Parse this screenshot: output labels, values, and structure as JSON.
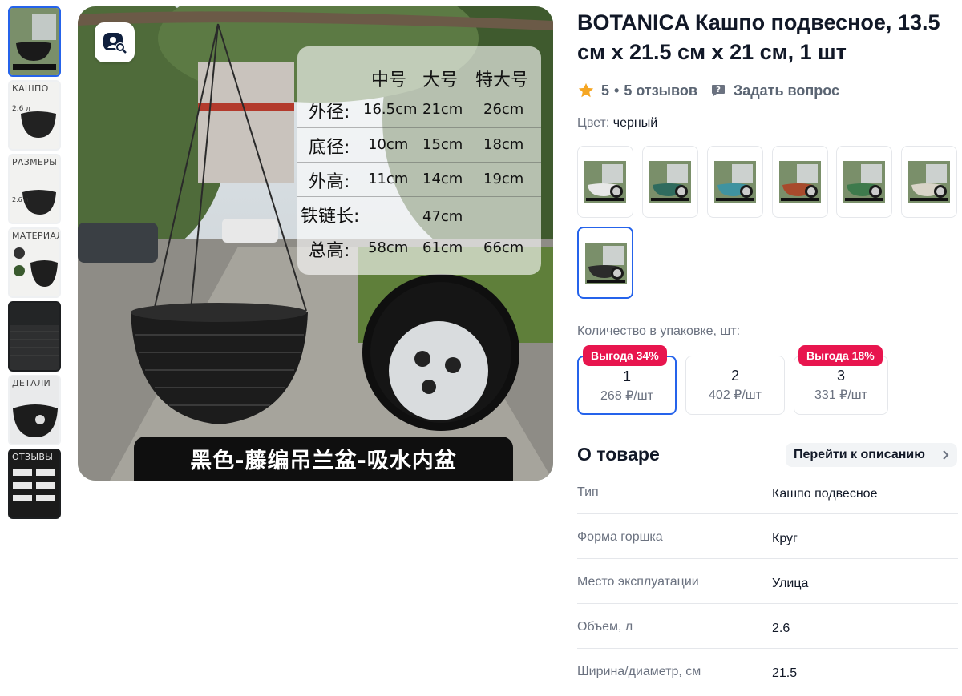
{
  "thumbnails": [
    {
      "label": ""
    },
    {
      "label": "КАШПО"
    },
    {
      "label": "РАЗМЕРЫ"
    },
    {
      "label": "МАТЕРИАЛ"
    },
    {
      "label": ""
    },
    {
      "label": "ДЕТАЛИ"
    },
    {
      "label": "ОТЗЫВЫ"
    }
  ],
  "main_image": {
    "spec_table": {
      "headers": [
        "中号",
        "大号",
        "特大号"
      ],
      "rows": [
        {
          "label": "外径:",
          "values": [
            "16.5cm",
            "21cm",
            "26cm"
          ]
        },
        {
          "label": "底径:",
          "values": [
            "10cm",
            "15cm",
            "18cm"
          ]
        },
        {
          "label": "外高:",
          "values": [
            "11cm",
            "14cm",
            "19cm"
          ]
        },
        {
          "label": "铁链长:",
          "values": [
            "",
            "47cm",
            ""
          ]
        },
        {
          "label": "总高:",
          "values": [
            "58cm",
            "61cm",
            "66cm"
          ]
        }
      ]
    },
    "banner": "黑色-藤编吊兰盆-吸水内盆"
  },
  "product": {
    "title": "BOTANICA Кашпо подвесное, 13.5 см х 21.5 см х 21 см, 1 шт",
    "rating": "5",
    "separator": "•",
    "reviews": "5 отзывов",
    "ask": "Задать вопрос",
    "color_label": "Цвет:",
    "color_value": "черный",
    "swatch_colors": [
      "#e8e8e8",
      "#2f6b5e",
      "#3f93a0",
      "#a84a2c",
      "#3e7a4c",
      "#d9d4c8",
      "#2b2b2b"
    ],
    "qty_label": "Количество в упаковке, шт:",
    "qty_options": [
      {
        "count": "1",
        "price": "268 ₽/шт",
        "badge": "Выгода 34%",
        "selected": true
      },
      {
        "count": "2",
        "price": "402 ₽/шт",
        "badge": "",
        "selected": false
      },
      {
        "count": "3",
        "price": "331 ₽/шт",
        "badge": "Выгода 18%",
        "selected": false
      }
    ],
    "about_title": "О товаре",
    "goto_desc": "Перейти к описанию",
    "attributes": [
      {
        "key": "Тип",
        "value": "Кашпо подвесное"
      },
      {
        "key": "Форма горшка",
        "value": "Круг"
      },
      {
        "key": "Место эксплуатации",
        "value": "Улица"
      },
      {
        "key": "Объем, л",
        "value": "2.6"
      },
      {
        "key": "Ширина/диаметр, см",
        "value": "21.5"
      }
    ]
  },
  "colors": {
    "accent": "#2563eb",
    "badge": "#e8154e",
    "star": "#f5a623"
  }
}
